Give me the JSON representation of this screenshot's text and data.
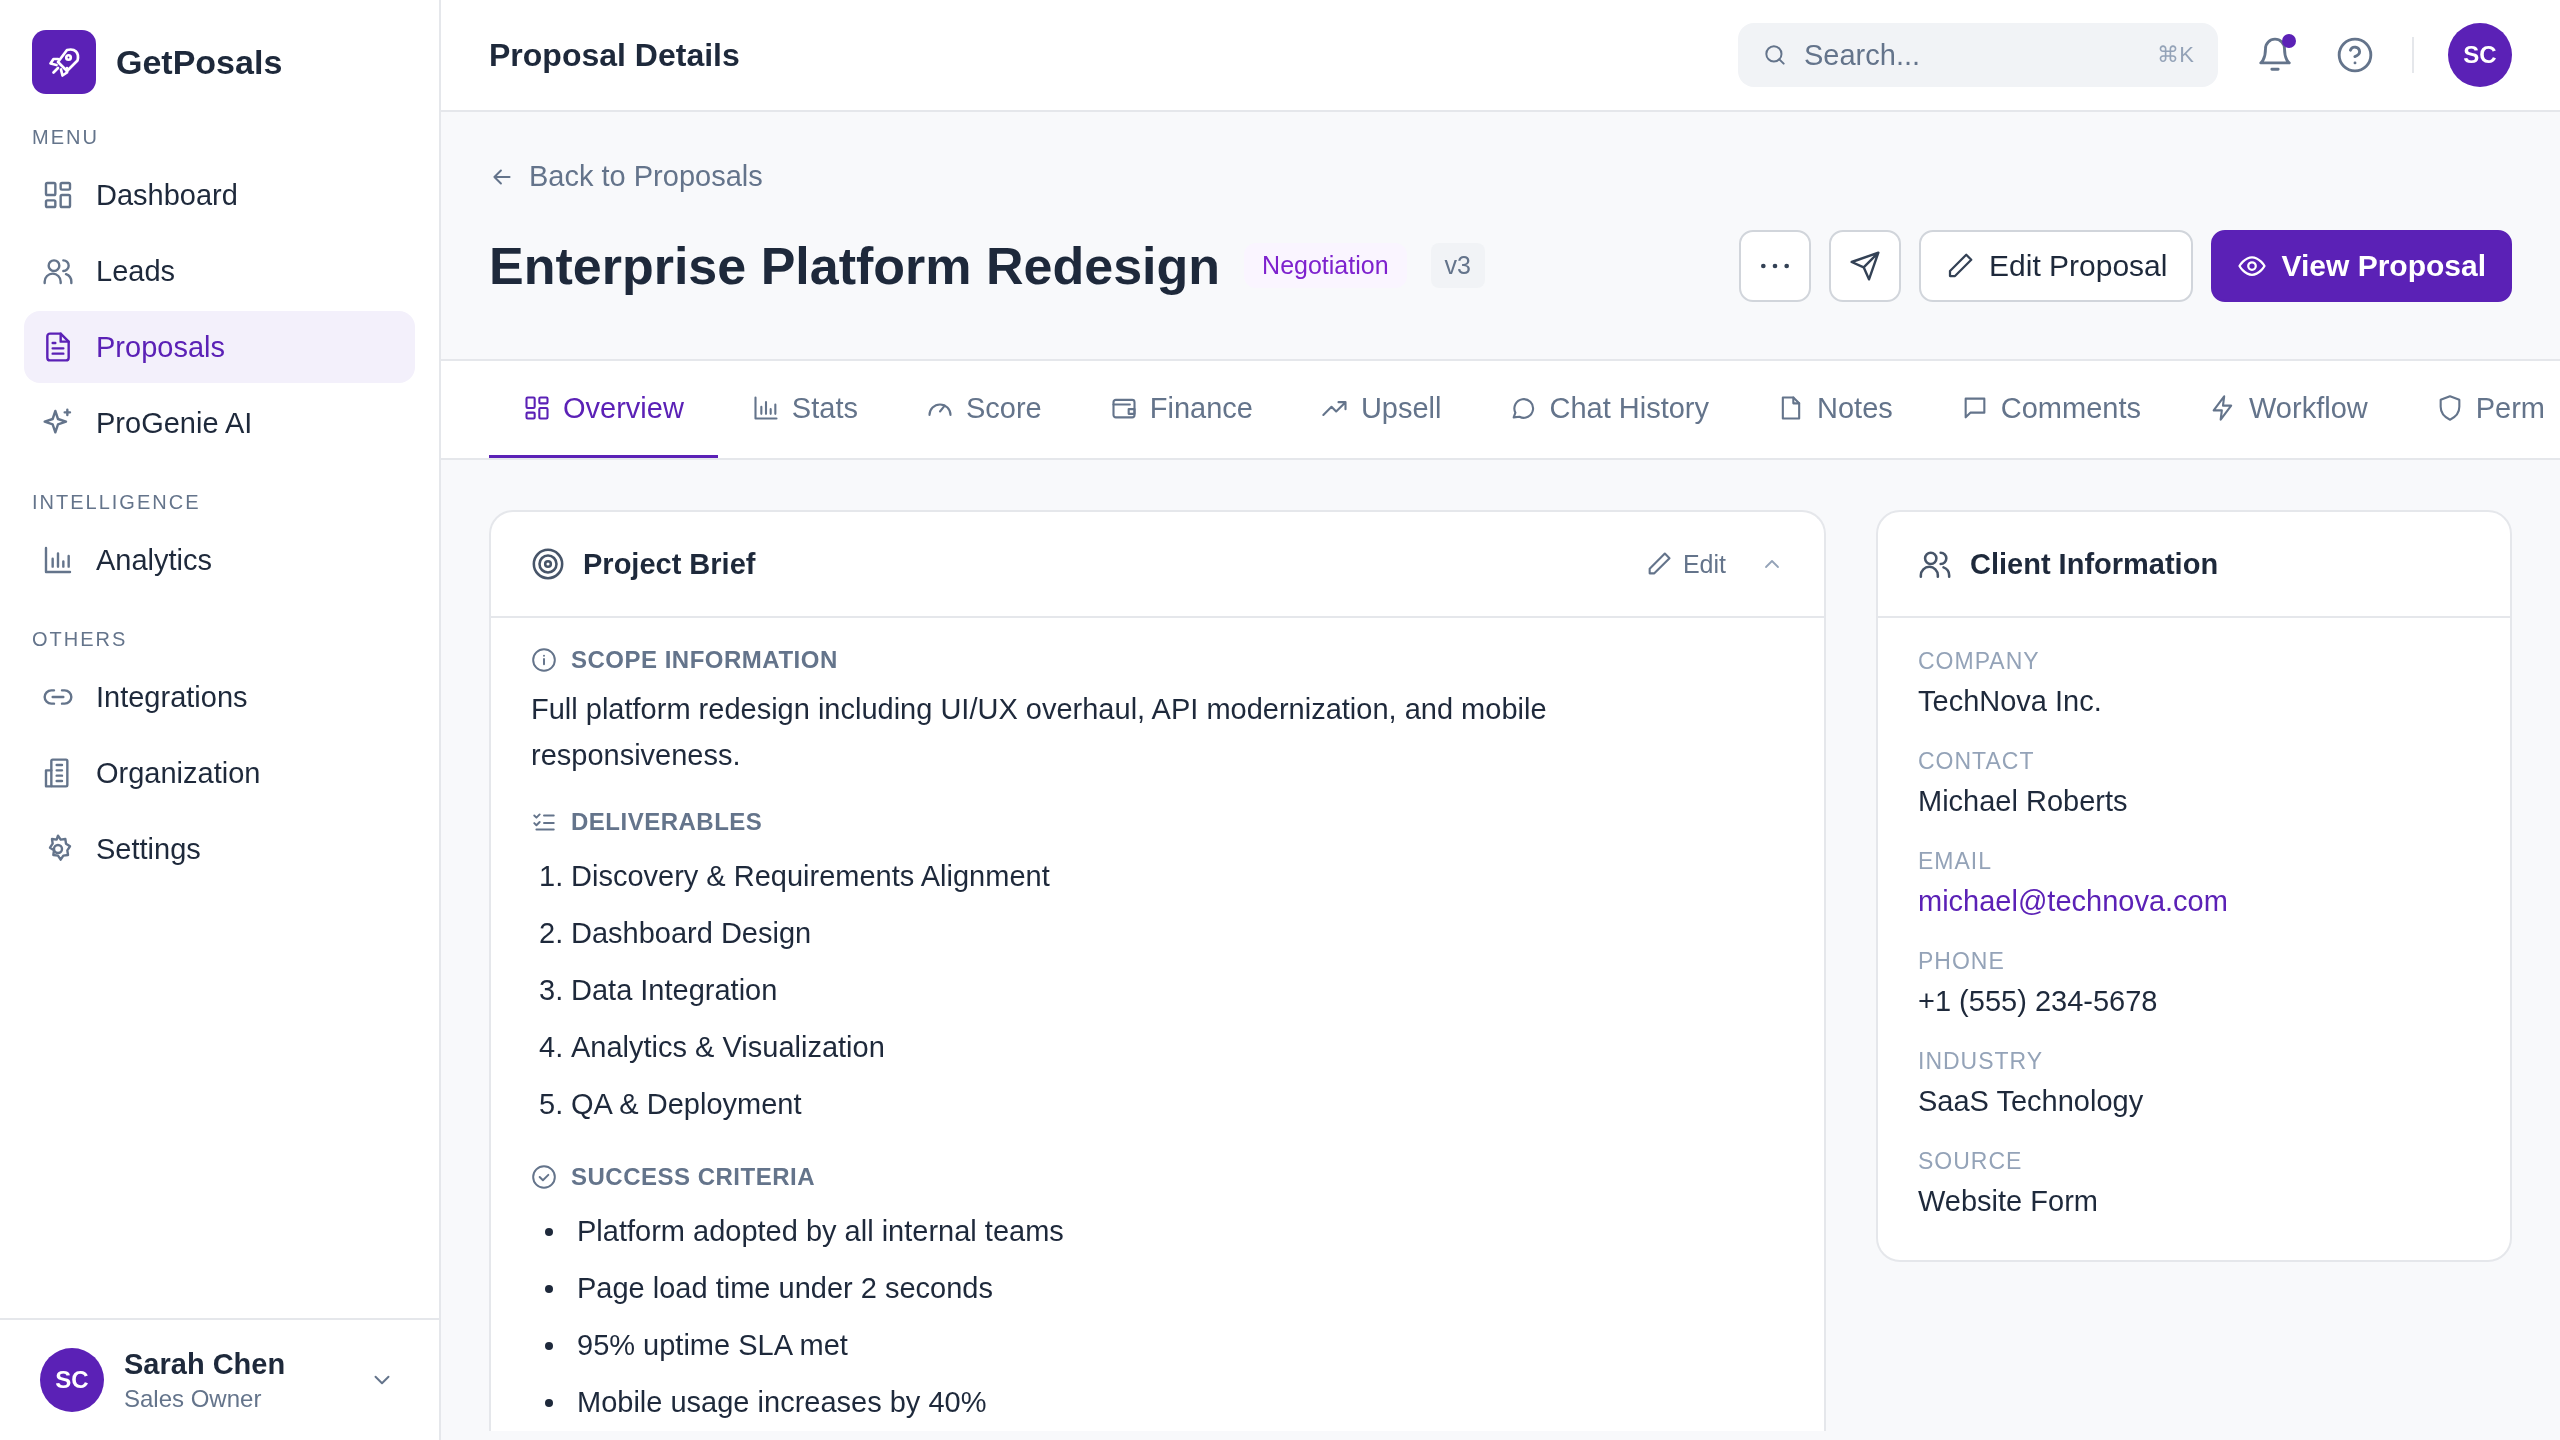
{
  "app": {
    "name": "GetPosals"
  },
  "sidebar": {
    "sections": [
      {
        "label": "MENU",
        "items": [
          {
            "label": "Dashboard",
            "selected": false
          },
          {
            "label": "Leads",
            "selected": false
          },
          {
            "label": "Proposals",
            "selected": true
          },
          {
            "label": "ProGenie AI",
            "selected": false
          }
        ]
      },
      {
        "label": "INTELLIGENCE",
        "items": [
          {
            "label": "Analytics",
            "selected": false
          }
        ]
      },
      {
        "label": "OTHERS",
        "items": [
          {
            "label": "Integrations",
            "selected": false
          },
          {
            "label": "Organization",
            "selected": false
          },
          {
            "label": "Settings",
            "selected": false
          }
        ]
      }
    ]
  },
  "user": {
    "initials": "SC",
    "name": "Sarah Chen",
    "role": "Sales Owner"
  },
  "header": {
    "title": "Proposal Details",
    "search": {
      "placeholder": "Search...",
      "shortcut": "⌘K"
    },
    "notifications_unread": true,
    "avatar": "SC"
  },
  "back_link": "Back to Proposals",
  "proposal": {
    "title": "Enterprise Platform Redesign",
    "status": "Negotiation",
    "version": "v3"
  },
  "actions": [
    {
      "kind": "more"
    },
    {
      "kind": "send"
    },
    {
      "kind": "secondary",
      "label": "Edit Proposal"
    },
    {
      "kind": "primary",
      "label": "View Proposal"
    }
  ],
  "tabs": [
    {
      "label": "Overview",
      "selected": true
    },
    {
      "label": "Stats",
      "selected": false
    },
    {
      "label": "Score",
      "selected": false
    },
    {
      "label": "Finance",
      "selected": false
    },
    {
      "label": "Upsell",
      "selected": false
    },
    {
      "label": "Chat History",
      "selected": false
    },
    {
      "label": "Notes",
      "selected": false
    },
    {
      "label": "Comments",
      "selected": false
    },
    {
      "label": "Workflow",
      "selected": false
    },
    {
      "label": "Perm",
      "selected": false
    }
  ],
  "project_brief": {
    "title": "Project Brief",
    "edit_label": "Edit",
    "expanded": true,
    "sections": [
      {
        "kind": "text",
        "heading": "SCOPE INFORMATION",
        "text": "Full platform redesign including UI/UX overhaul, API modernization, and mobile responsiveness."
      },
      {
        "kind": "ordered",
        "heading": "DELIVERABLES",
        "items": [
          {
            "marker": "1.",
            "text": "Discovery & Requirements Alignment"
          },
          {
            "marker": "2.",
            "text": "Dashboard Design"
          },
          {
            "marker": "3.",
            "text": "Data Integration"
          },
          {
            "marker": "4.",
            "text": "Analytics & Visualization"
          },
          {
            "marker": "5.",
            "text": "QA & Deployment"
          }
        ]
      },
      {
        "kind": "bullets",
        "heading": "SUCCESS CRITERIA",
        "items": [
          "Platform adopted by all internal teams",
          "Page load time under 2 seconds",
          "95% uptime SLA met",
          "Mobile usage increases by 40%"
        ]
      }
    ]
  },
  "client_info": {
    "title": "Client Information",
    "fields": [
      {
        "label": "COMPANY",
        "value": "TechNova Inc.",
        "kind": "text"
      },
      {
        "label": "CONTACT",
        "value": "Michael Roberts",
        "kind": "text"
      },
      {
        "label": "EMAIL",
        "value": "michael@technova.com",
        "kind": "link"
      },
      {
        "label": "PHONE",
        "value": "+1 (555) 234-5678",
        "kind": "text"
      },
      {
        "label": "INDUSTRY",
        "value": "SaaS Technology",
        "kind": "text"
      },
      {
        "label": "SOURCE",
        "value": "Website Form",
        "kind": "text"
      }
    ]
  }
}
